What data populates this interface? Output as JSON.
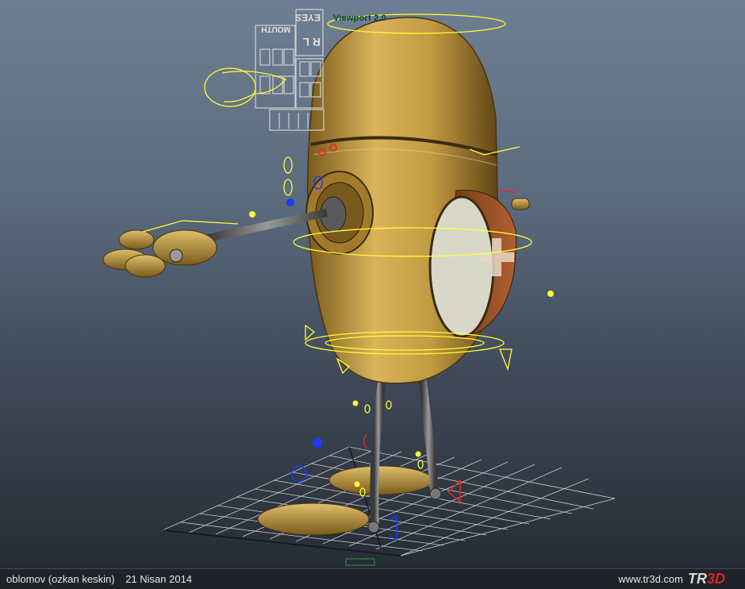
{
  "viewport": {
    "label": "Viewport 2.0",
    "face_controls": {
      "eyes_label": "EYES",
      "rl_label": "R L",
      "mouth_label": "MOUTH"
    }
  },
  "footer": {
    "author": "oblomov (ozkan keskin)",
    "date": "21 Nisan 2014",
    "site": "www.tr3d.com",
    "logo_text": "TR",
    "logo_accent": "3D"
  },
  "colors": {
    "rig_control": "#ffff33",
    "body_gold": "#c9a048",
    "grid_line": "#e6e6e6"
  }
}
